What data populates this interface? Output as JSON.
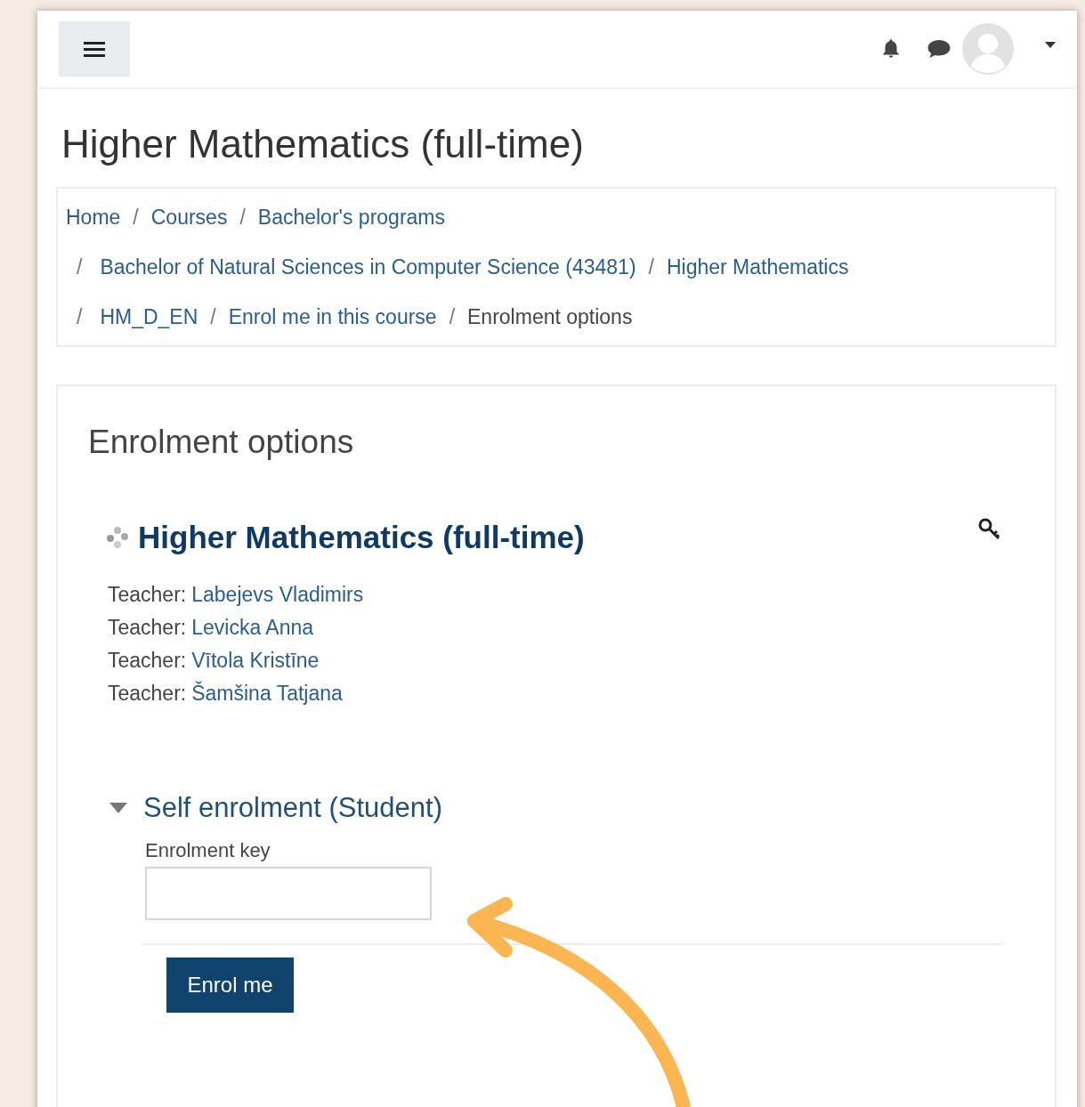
{
  "page_title": "Higher Mathematics (full-time)",
  "breadcrumb": {
    "separator": "/",
    "lines": [
      [
        {
          "text": "Home",
          "kind": "link"
        },
        {
          "text": "Courses",
          "kind": "link"
        },
        {
          "text": "Bachelor's programs",
          "kind": "link"
        }
      ],
      [
        {
          "text": "Bachelor of Natural Sciences in Computer Science (43481)",
          "kind": "link"
        },
        {
          "text": "Higher Mathematics",
          "kind": "link"
        }
      ],
      [
        {
          "text": "HM_D_EN",
          "kind": "link"
        },
        {
          "text": "Enrol me in this course",
          "kind": "link"
        },
        {
          "text": "Enrolment options",
          "kind": "current"
        }
      ]
    ]
  },
  "card": {
    "heading": "Enrolment options",
    "course_title": "Higher Mathematics (full-time)",
    "teachers": [
      {
        "label": "Teacher:",
        "name": "Labejevs Vladimirs"
      },
      {
        "label": "Teacher:",
        "name": "Levicka Anna"
      },
      {
        "label": "Teacher:",
        "name": "Vītola Kristīne"
      },
      {
        "label": "Teacher:",
        "name": "Šamšina Tatjana"
      }
    ],
    "section": {
      "title": "Self enrolment (Student)",
      "expanded": true,
      "field_label": "Enrolment key",
      "button": "Enrol me"
    }
  }
}
